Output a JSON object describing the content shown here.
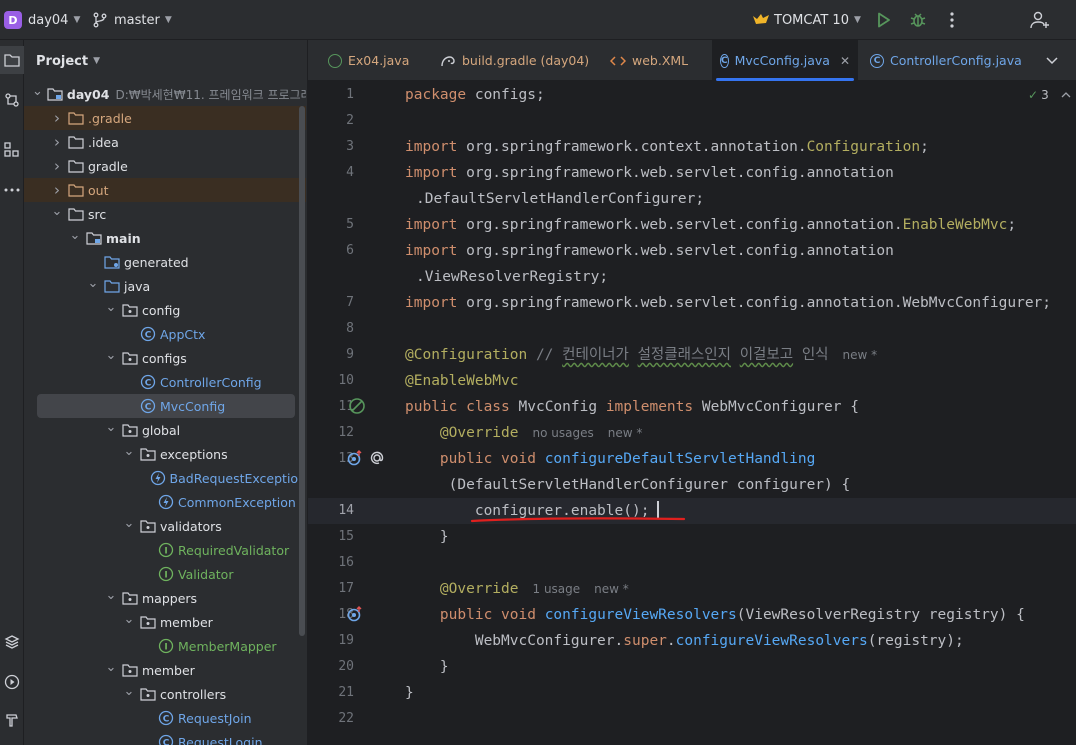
{
  "titlebar": {
    "project_badge": "D",
    "project_name": "day04",
    "branch": "master",
    "run_config": "TOMCAT 10"
  },
  "project_panel": {
    "title": "Project",
    "tree": [
      {
        "label": "day04",
        "path": "D:₩박세현₩11. 프레임워크 프로그래",
        "depth": 0,
        "expanded": true,
        "icon": "module-folder-icon",
        "style": "bold"
      },
      {
        "label": ".gradle",
        "depth": 1,
        "expanded": false,
        "icon": "folder-excluded-icon",
        "style": "orange"
      },
      {
        "label": ".idea",
        "depth": 1,
        "expanded": false,
        "icon": "folder-icon",
        "style": ""
      },
      {
        "label": "gradle",
        "depth": 1,
        "expanded": false,
        "icon": "folder-icon",
        "style": ""
      },
      {
        "label": "out",
        "depth": 1,
        "expanded": false,
        "icon": "folder-excluded-icon",
        "style": "orange"
      },
      {
        "label": "src",
        "depth": 1,
        "expanded": true,
        "icon": "folder-icon",
        "style": ""
      },
      {
        "label": "main",
        "depth": 2,
        "expanded": true,
        "icon": "module-folder-icon",
        "style": "bold"
      },
      {
        "label": "generated",
        "depth": 3,
        "expanded": null,
        "icon": "generated-folder-icon",
        "style": ""
      },
      {
        "label": "java",
        "depth": 3,
        "expanded": true,
        "icon": "source-folder-icon",
        "style": ""
      },
      {
        "label": "config",
        "depth": 4,
        "expanded": true,
        "icon": "package-icon",
        "style": ""
      },
      {
        "label": "AppCtx",
        "depth": 5,
        "expanded": null,
        "icon": "class-icon",
        "style": "blue"
      },
      {
        "label": "configs",
        "depth": 4,
        "expanded": true,
        "icon": "package-icon",
        "style": ""
      },
      {
        "label": "ControllerConfig",
        "depth": 5,
        "expanded": null,
        "icon": "class-icon",
        "style": "blue"
      },
      {
        "label": "MvcConfig",
        "depth": 5,
        "expanded": null,
        "icon": "class-icon",
        "style": "blue"
      },
      {
        "label": "global",
        "depth": 4,
        "expanded": true,
        "icon": "package-icon",
        "style": ""
      },
      {
        "label": "exceptions",
        "depth": 5,
        "expanded": true,
        "icon": "package-icon",
        "style": ""
      },
      {
        "label": "BadRequestException",
        "depth": 6,
        "expanded": null,
        "icon": "exception-class-icon",
        "style": "blue"
      },
      {
        "label": "CommonException",
        "depth": 6,
        "expanded": null,
        "icon": "exception-class-icon",
        "style": "blue"
      },
      {
        "label": "validators",
        "depth": 5,
        "expanded": true,
        "icon": "package-icon",
        "style": ""
      },
      {
        "label": "RequiredValidator",
        "depth": 6,
        "expanded": null,
        "icon": "interface-icon",
        "style": "green"
      },
      {
        "label": "Validator",
        "depth": 6,
        "expanded": null,
        "icon": "interface-icon",
        "style": "green"
      },
      {
        "label": "mappers",
        "depth": 4,
        "expanded": true,
        "icon": "package-icon",
        "style": ""
      },
      {
        "label": "member",
        "depth": 5,
        "expanded": true,
        "icon": "package-icon",
        "style": ""
      },
      {
        "label": "MemberMapper",
        "depth": 6,
        "expanded": null,
        "icon": "interface-icon",
        "style": "green"
      },
      {
        "label": "member",
        "depth": 4,
        "expanded": true,
        "icon": "package-icon",
        "style": ""
      },
      {
        "label": "controllers",
        "depth": 5,
        "expanded": true,
        "icon": "package-icon",
        "style": ""
      },
      {
        "label": "RequestJoin",
        "depth": 6,
        "expanded": null,
        "icon": "class-icon",
        "style": "blue"
      },
      {
        "label": "RequestLogin",
        "depth": 6,
        "expanded": null,
        "icon": "class-icon",
        "style": "blue"
      }
    ],
    "selected_index": 13
  },
  "tabs": [
    {
      "label": "Ex04.java",
      "icon": "java-file-icon",
      "active": false
    },
    {
      "label": "build.gradle (day04)",
      "icon": "gradle-icon",
      "active": false
    },
    {
      "label": "web.XML",
      "icon": "xml-file-icon",
      "active": false
    },
    {
      "label": "MvcConfig.java",
      "icon": "class-icon",
      "active": true
    },
    {
      "label": "ControllerConfig.java",
      "icon": "class-icon",
      "active": false
    }
  ],
  "editor": {
    "inspection_count": "3",
    "current_line": 14,
    "hints": {
      "new": "new *",
      "no_usages": "no usages",
      "one_usage": "1 usage"
    },
    "lines": [
      {
        "n": "1",
        "code": [
          [
            "kw",
            "package "
          ],
          [
            "",
            "configs;"
          ]
        ]
      },
      {
        "n": "2",
        "code": []
      },
      {
        "n": "3",
        "code": [
          [
            "kw",
            "import "
          ],
          [
            "",
            "org.springframework.context.annotation."
          ],
          [
            "ann",
            "Configuration"
          ],
          [
            "",
            ";"
          ]
        ]
      },
      {
        "n": "4",
        "code": [
          [
            "kw",
            "import "
          ],
          [
            "",
            "org.springframework.web.servlet.config.annotation"
          ]
        ]
      },
      {
        "n": "",
        "code": [
          [
            "",
            ".DefaultServletHandlerConfigurer;"
          ]
        ],
        "indent": 1
      },
      {
        "n": "5",
        "code": [
          [
            "kw",
            "import "
          ],
          [
            "",
            "org.springframework.web.servlet.config.annotation."
          ],
          [
            "ann",
            "EnableWebMvc"
          ],
          [
            "",
            ";"
          ]
        ]
      },
      {
        "n": "6",
        "code": [
          [
            "kw",
            "import "
          ],
          [
            "",
            "org.springframework.web.servlet.config.annotation"
          ]
        ]
      },
      {
        "n": "",
        "code": [
          [
            "",
            ".ViewResolverRegistry;"
          ]
        ],
        "indent": 1
      },
      {
        "n": "7",
        "code": [
          [
            "kw",
            "import "
          ],
          [
            "",
            "org.springframework.web.servlet.config.annotation.WebMvcConfigurer;"
          ]
        ]
      },
      {
        "n": "8",
        "code": []
      },
      {
        "n": "9",
        "code": [
          [
            "ann",
            "@Configuration"
          ],
          [
            "",
            " "
          ],
          [
            "cmt",
            "// "
          ],
          [
            "sq",
            "컨테이너가"
          ],
          [
            "cmt",
            " "
          ],
          [
            "sq",
            "설정클래스인지"
          ],
          [
            "cmt",
            " "
          ],
          [
            "sq",
            "이걸보고"
          ],
          [
            "cmt",
            " 인식"
          ],
          [
            "hint-new",
            ""
          ]
        ]
      },
      {
        "n": "10",
        "code": [
          [
            "ann",
            "@EnableWebMvc"
          ]
        ]
      },
      {
        "n": "11",
        "code": [
          [
            "kw",
            "public class "
          ],
          [
            "",
            "MvcConfig "
          ],
          [
            "kw",
            "implements "
          ],
          [
            "",
            "WebMvcConfigurer {"
          ]
        ]
      },
      {
        "n": "12",
        "code": [
          [
            "",
            "    "
          ],
          [
            "ann",
            "@Override"
          ],
          [
            "hint-no_usages",
            ""
          ],
          [
            "hint-new",
            ""
          ]
        ]
      },
      {
        "n": "13",
        "code": [
          [
            "",
            "    "
          ],
          [
            "kw",
            "public void "
          ],
          [
            "fn",
            "configureDefaultServletHandling"
          ]
        ]
      },
      {
        "n": "",
        "code": [
          [
            "",
            "     (DefaultServletHandlerConfigurer configurer) {"
          ]
        ]
      },
      {
        "n": "14",
        "code": [
          [
            "",
            "        configurer.enable();"
          ]
        ]
      },
      {
        "n": "15",
        "code": [
          [
            "",
            "    }"
          ]
        ]
      },
      {
        "n": "16",
        "code": []
      },
      {
        "n": "17",
        "code": [
          [
            "",
            "    "
          ],
          [
            "ann",
            "@Override"
          ],
          [
            "hint-one_usage",
            ""
          ],
          [
            "hint-new",
            ""
          ]
        ]
      },
      {
        "n": "18",
        "code": [
          [
            "",
            "    "
          ],
          [
            "kw",
            "public void "
          ],
          [
            "fn",
            "configureViewResolvers"
          ],
          [
            "",
            "(ViewResolverRegistry registry) {"
          ]
        ]
      },
      {
        "n": "19",
        "code": [
          [
            "",
            "        WebMvcConfigurer."
          ],
          [
            "kw",
            "super"
          ],
          [
            "",
            "."
          ],
          [
            "fn",
            "configureViewResolvers"
          ],
          [
            "",
            "(registry);"
          ]
        ]
      },
      {
        "n": "20",
        "code": [
          [
            "",
            "    }"
          ]
        ]
      },
      {
        "n": "21",
        "code": [
          [
            "",
            "}"
          ]
        ]
      },
      {
        "n": "22",
        "code": []
      }
    ]
  },
  "colors": {
    "accent": "#3574f0",
    "annotation_underline": "#e0201e"
  }
}
